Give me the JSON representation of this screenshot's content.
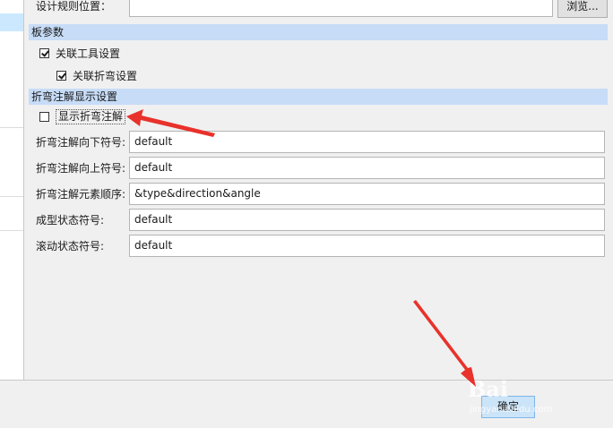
{
  "design_rule_location": {
    "label": "设计规则位置：",
    "value": "",
    "browse_label": "浏览..."
  },
  "sheet_params": {
    "header": "板参数",
    "link_tool_settings": {
      "label": "关联工具设置",
      "checked": true
    },
    "link_bend_settings": {
      "label": "关联折弯设置",
      "checked": true
    }
  },
  "bend_annotation": {
    "header": "折弯注解显示设置",
    "show_bend_annotation": {
      "label": "显示折弯注解",
      "checked": false
    },
    "fields": [
      {
        "label": "折弯注解向下符号:",
        "value": "default"
      },
      {
        "label": "折弯注解向上符号:",
        "value": "default"
      },
      {
        "label": "折弯注解元素顺序:",
        "value": "&type&direction&angle"
      },
      {
        "label": "成型状态符号:",
        "value": "default"
      },
      {
        "label": "滚动状态符号:",
        "value": "default"
      }
    ]
  },
  "footer": {
    "ok_label": "确定"
  },
  "watermark": {
    "main": "Bai",
    "sub": "jingyan.baidu.com"
  },
  "colors": {
    "arrow": "#e8322b",
    "section_header": "#c7dcf7",
    "ok_button": "#cce4f7"
  }
}
